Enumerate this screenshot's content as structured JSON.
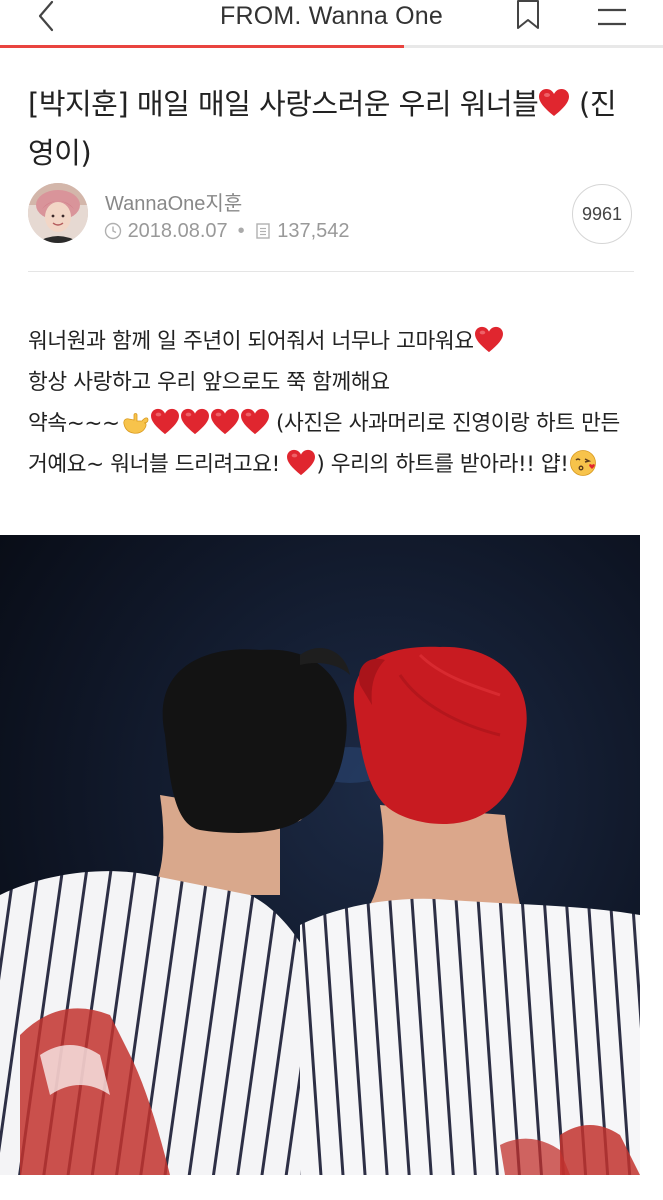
{
  "header": {
    "title": "FROM. Wanna One",
    "back_icon": "chevron-left-icon",
    "bookmark_icon": "bookmark-icon",
    "menu_icon": "hamburger-menu-icon"
  },
  "reading_progress": 0.61,
  "post": {
    "title_text": "[박지훈] 매일 매일 사랑스러운 우리 워너블",
    "title_tail": " (진영이)",
    "author": "WannaOne지훈",
    "date": "2018.08.07",
    "views": "137,542",
    "like_count": "9961",
    "body": {
      "line1": "워너원과 함께 일 주년이 되어줘서 너무나 고마워요",
      "line2": "항상 사랑하고 우리 앞으로도 쭉 함께해요",
      "line3_start": "약속~~~",
      "line3_end": " (사진은 사과머리로 진영이랑 하트 만든 거예요~ 워너블 드리려고요! ",
      "line3_after": ") 우리의 하트를 받아라!! 얍!"
    }
  },
  "colors": {
    "accent": "#e9443f",
    "heart": "#e0262f",
    "text": "#222222",
    "meta": "#999999"
  }
}
